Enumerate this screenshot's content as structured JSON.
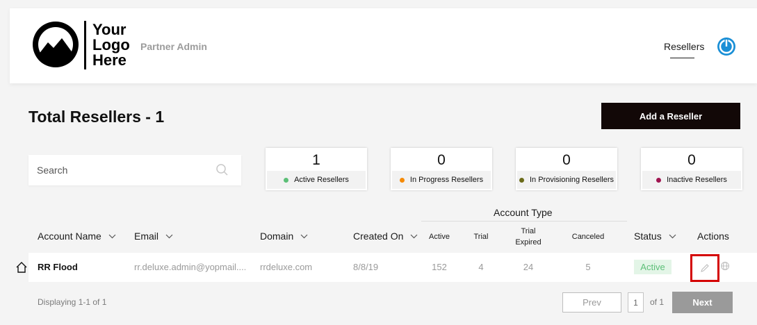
{
  "header": {
    "logo_lines": [
      "Your",
      "Logo",
      "Here"
    ],
    "subtitle": "Partner Admin",
    "nav_item": "Resellers",
    "accent_color": "#1a8fd6"
  },
  "page": {
    "title": "Total Resellers - 1",
    "add_button": "Add a Reseller"
  },
  "search": {
    "placeholder": "Search"
  },
  "stats": [
    {
      "value": "1",
      "label": "Active Resellers",
      "dot_color": "#5cbf77"
    },
    {
      "value": "0",
      "label": "In Progress Resellers",
      "dot_color": "#f58a07"
    },
    {
      "value": "0",
      "label": "In Provisioning Resellers",
      "dot_color": "#6b6b1a"
    },
    {
      "value": "0",
      "label": "Inactive Resellers",
      "dot_color": "#a01550"
    }
  ],
  "table": {
    "group_header": "Account Type",
    "columns": {
      "account_name": "Account Name",
      "email": "Email",
      "domain": "Domain",
      "created_on": "Created On",
      "active": "Active",
      "trial": "Trial",
      "trial_expired_1": "Trial",
      "trial_expired_2": "Expired",
      "canceled": "Canceled",
      "status": "Status",
      "actions": "Actions"
    },
    "rows": [
      {
        "account_name": "RR Flood",
        "email": "rr.deluxe.admin@yopmail....",
        "domain": "rrdeluxe.com",
        "created_on": "8/8/19",
        "active": "152",
        "trial": "4",
        "trial_expired": "24",
        "canceled": "5",
        "status": "Active"
      }
    ]
  },
  "pagination": {
    "summary": "Displaying 1-1 of 1",
    "prev": "Prev",
    "page": "1",
    "of": "of 1",
    "next": "Next"
  }
}
